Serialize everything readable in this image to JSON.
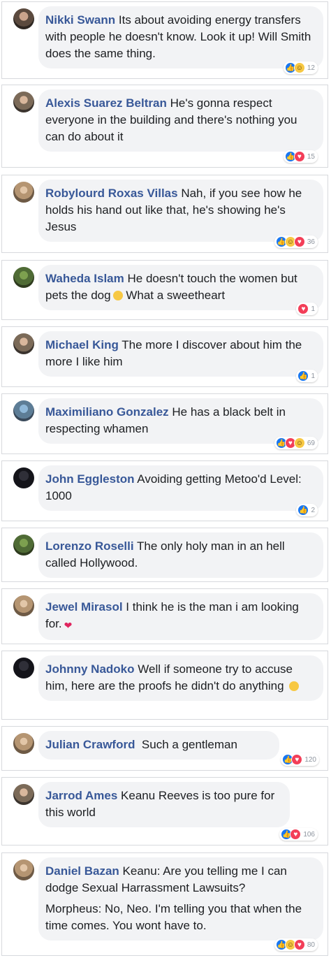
{
  "colors": {
    "author_link": "#385898",
    "bubble_bg": "#f2f3f5",
    "text": "#1c1e21",
    "like": "#1877f2",
    "love": "#f33e58",
    "haha": "#f7c843",
    "count": "#8d949e"
  },
  "comments": [
    {
      "author": "Nikki Swann",
      "text": "Its about avoiding energy transfers with people he doesn't know. Look it up! Will Smith does the same thing.",
      "reactions": [
        "like",
        "haha"
      ],
      "count": "12"
    },
    {
      "author": "Alexis Suarez Beltran",
      "text": "He's gonna respect everyone in the building and there's nothing you can do about it",
      "reactions": [
        "like",
        "love"
      ],
      "count": "15"
    },
    {
      "author": "Robylourd Roxas Villas",
      "text": "Nah, if you see how he holds his hand out like that, he's showing he's Jesus",
      "reactions": [
        "like",
        "haha",
        "love"
      ],
      "count": "36"
    },
    {
      "author": "Waheda Islam",
      "text": "He doesn't touch the women but pets the dog",
      "emoji": "laughing-emoji",
      "text_after": "What a sweetheart",
      "reactions": [
        "love"
      ],
      "count": "1"
    },
    {
      "author": "Michael King",
      "text": "The more I discover about him the more I like him",
      "reactions": [
        "like"
      ],
      "count": "1"
    },
    {
      "author": "Maximiliano Gonzalez",
      "text": "He has a black belt in respecting whamen",
      "reactions": [
        "like",
        "love",
        "haha"
      ],
      "count": "69"
    },
    {
      "author": "John Eggleston",
      "text": "Avoiding getting Metoo'd Level: 1000",
      "reactions": [
        "like"
      ],
      "count": "2"
    },
    {
      "author": "Lorenzo Roselli",
      "text": "The only holy man in an hell called Hollywood."
    },
    {
      "author": "Jewel Mirasol",
      "text": "I think he is the man i am looking for.",
      "emoji": "heart-emoji"
    },
    {
      "author": "Johnny Nadoko",
      "text": "Well if someone try to accuse him, here are the proofs he didn't do anything",
      "emoji": "rofl-emoji"
    },
    {
      "author": "Julian Crawford",
      "text": "Such a gentleman",
      "reactions": [
        "like",
        "love"
      ],
      "count": "120"
    },
    {
      "author": "Jarrod Ames",
      "text": "Keanu Reeves is too pure for this world",
      "reactions": [
        "like",
        "love"
      ],
      "count": "106"
    },
    {
      "author": "Daniel Bazan",
      "text": "Keanu: Are you telling me I can dodge Sexual Harrassment Lawsuits?",
      "text2": "Morpheus: No, Neo. I'm telling you that when the time comes. You wont have to.",
      "reactions": [
        "like",
        "haha",
        "love"
      ],
      "count": "80"
    }
  ]
}
